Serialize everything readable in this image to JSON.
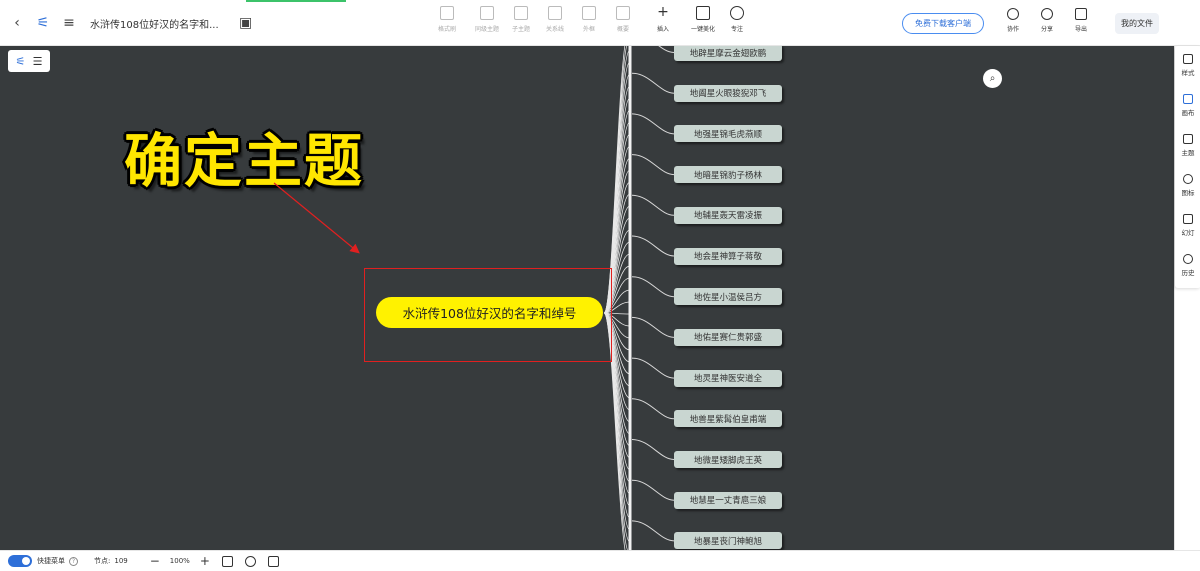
{
  "toolbar": {
    "doc_title": "水浒传108位好汉的名字和...",
    "tools": [
      {
        "label": "格式刷",
        "active": false
      },
      {
        "label": "同级主题",
        "active": false
      },
      {
        "label": "子主题",
        "active": false
      },
      {
        "label": "关系线",
        "active": false
      },
      {
        "label": "外框",
        "active": false
      },
      {
        "label": "概要",
        "active": false
      },
      {
        "label": "插入",
        "active": true
      },
      {
        "label": "一键美化",
        "active": true
      },
      {
        "label": "专注",
        "active": true
      }
    ],
    "download_client": "免费下载客户端",
    "right_tools": [
      {
        "label": "协作"
      },
      {
        "label": "分享"
      },
      {
        "label": "导出"
      }
    ],
    "my_files": "我的文件"
  },
  "canvas": {
    "overlay_title": "确定主题",
    "central_topic": "水浒传108位好汉的名字和绰号",
    "leaves": [
      "地辟星摩云金翅欧鹏",
      "地阖星火眼狻猊邓飞",
      "地强星锦毛虎燕顺",
      "地暗星锦豹子杨林",
      "地辅星轰天雷凌振",
      "地会星神算子蒋敬",
      "地佐星小温侯吕方",
      "地佑星赛仁贵郭盛",
      "地灵星神医安道全",
      "地兽星紫髯伯皇甫端",
      "地微星矮脚虎王英",
      "地慧星一丈青扈三娘",
      "地暴星丧门神鲍旭"
    ]
  },
  "right_sidebar": [
    {
      "label": "样式",
      "icon": "style-icon"
    },
    {
      "label": "画布",
      "icon": "canvas-icon"
    },
    {
      "label": "主题",
      "icon": "theme-icon"
    },
    {
      "label": "图标",
      "icon": "emoji-icon"
    },
    {
      "label": "幻灯",
      "icon": "slides-icon"
    },
    {
      "label": "历史",
      "icon": "history-icon"
    }
  ],
  "statusbar": {
    "quick_menu": "快捷菜单",
    "nodes_label": "节点:",
    "nodes_count": "109",
    "zoom": "100%"
  },
  "colors": {
    "canvas_bg": "#373b3d",
    "central_node": "#fff200",
    "leaf_node": "#c9d6d1",
    "overlay_title": "#ffe600",
    "red_frame": "#e02020",
    "accent": "#2e6fd8"
  }
}
